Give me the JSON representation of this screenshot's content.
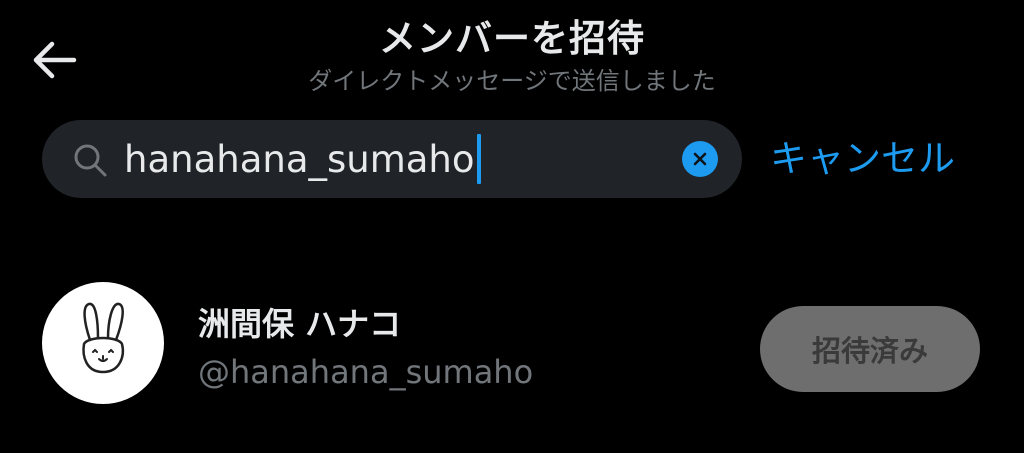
{
  "header": {
    "title": "メンバーを招待",
    "subtitle": "ダイレクトメッセージで送信しました"
  },
  "search": {
    "value": "hanahana_sumaho",
    "cancel_label": "キャンセル"
  },
  "results": [
    {
      "display_name": "洲間保 ハナコ",
      "handle": "@hanahana_sumaho",
      "button_label": "招待済み",
      "avatar_icon": "rabbit-drawing"
    }
  ],
  "colors": {
    "background": "#000000",
    "accent": "#1d9bf0",
    "search_bg": "#202327",
    "secondary_text": "#71767b",
    "disabled_button": "#6e6e6e"
  },
  "icons": {
    "back": "arrow-left-icon",
    "search": "search-icon",
    "clear": "clear-icon"
  }
}
